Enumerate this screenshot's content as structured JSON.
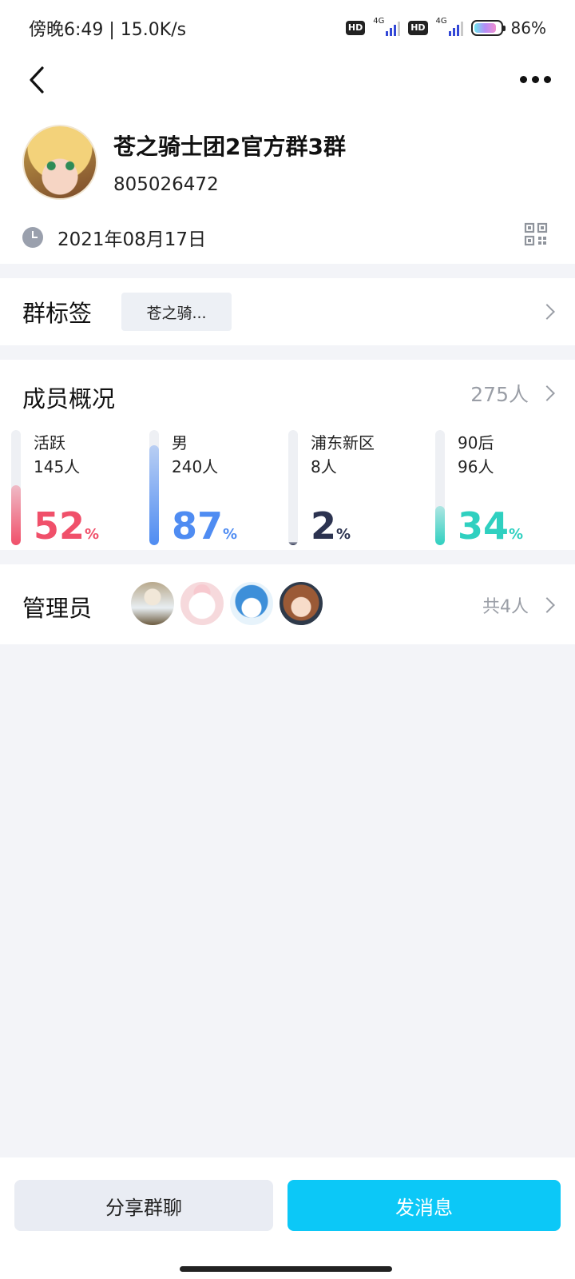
{
  "status_bar": {
    "time_speed": "傍晚6:49 | 15.0K/s",
    "hd": "HD",
    "network": "4G",
    "battery": "86%"
  },
  "group": {
    "name": "苍之骑士团2官方群3群",
    "id": "805026472",
    "created_date": "2021年08月17日"
  },
  "tags": {
    "label": "群标签",
    "chip": "苍之骑..."
  },
  "members": {
    "title": "成员概况",
    "count": "275人",
    "stats": [
      {
        "name": "活跃",
        "count": "145人",
        "percent": "52",
        "unit": "%",
        "fraction": 0.52,
        "color": "#f0506a"
      },
      {
        "name": "男",
        "count": "240人",
        "percent": "87",
        "unit": "%",
        "fraction": 0.87,
        "color": "#4f8cf2"
      },
      {
        "name": "浦东新区",
        "count": "8人",
        "percent": "2",
        "unit": "%",
        "fraction": 0.02,
        "color": "#2c3350"
      },
      {
        "name": "90后",
        "count": "96人",
        "percent": "34",
        "unit": "%",
        "fraction": 0.34,
        "color": "#2fd0c0"
      }
    ]
  },
  "admins": {
    "label": "管理员",
    "total": "共4人"
  },
  "actions": {
    "share": "分享群聊",
    "send": "发消息"
  }
}
